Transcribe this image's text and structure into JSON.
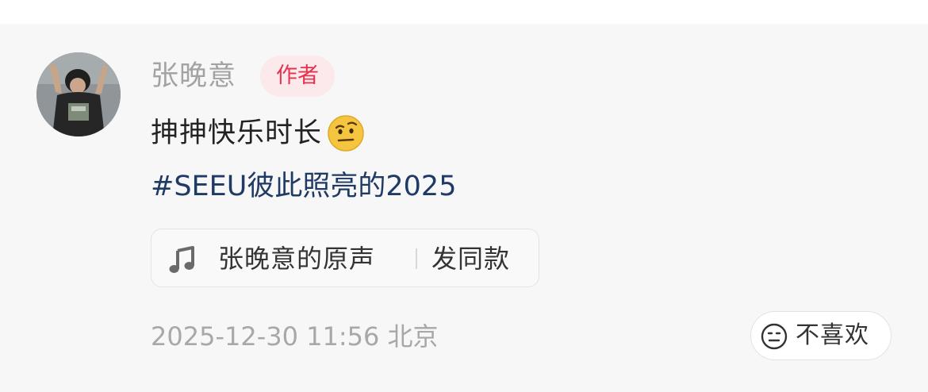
{
  "comment": {
    "author_name": "张晚意",
    "author_badge": "作者",
    "text": "抻抻快乐时长",
    "emoji": "raised-eyebrow-emoji",
    "hashtag": "#SEEU彼此照亮的2025",
    "sound": {
      "name": "张晚意的原声",
      "action": "发同款",
      "icon": "music-note-icon"
    },
    "timestamp": "2025-12-30 11:56",
    "location": "北京",
    "dislike_label": "不喜欢",
    "dislike_icon": "neutral-face-icon"
  },
  "colors": {
    "background": "#f7f7f7",
    "name": "#a3a3a3",
    "badge_bg": "#fbe9ec",
    "badge_text": "#e3334f",
    "hashtag": "#1f3a64",
    "meta": "#a8a8a8"
  }
}
